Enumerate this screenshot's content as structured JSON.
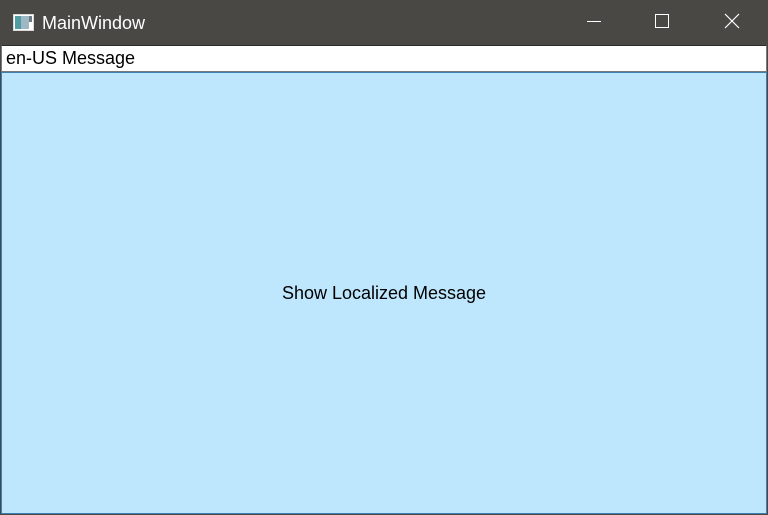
{
  "window": {
    "title": "MainWindow",
    "icons": {
      "app": "app-window-icon",
      "minimize": "minimize-icon",
      "maximize": "maximize-icon",
      "close": "close-icon"
    }
  },
  "message_field": {
    "value": "en-US Message"
  },
  "main": {
    "button_label": "Show Localized Message"
  },
  "colors": {
    "titlebar": "#4a4845",
    "button_background": "#bee6fd",
    "button_border": "#3c7fb1"
  }
}
